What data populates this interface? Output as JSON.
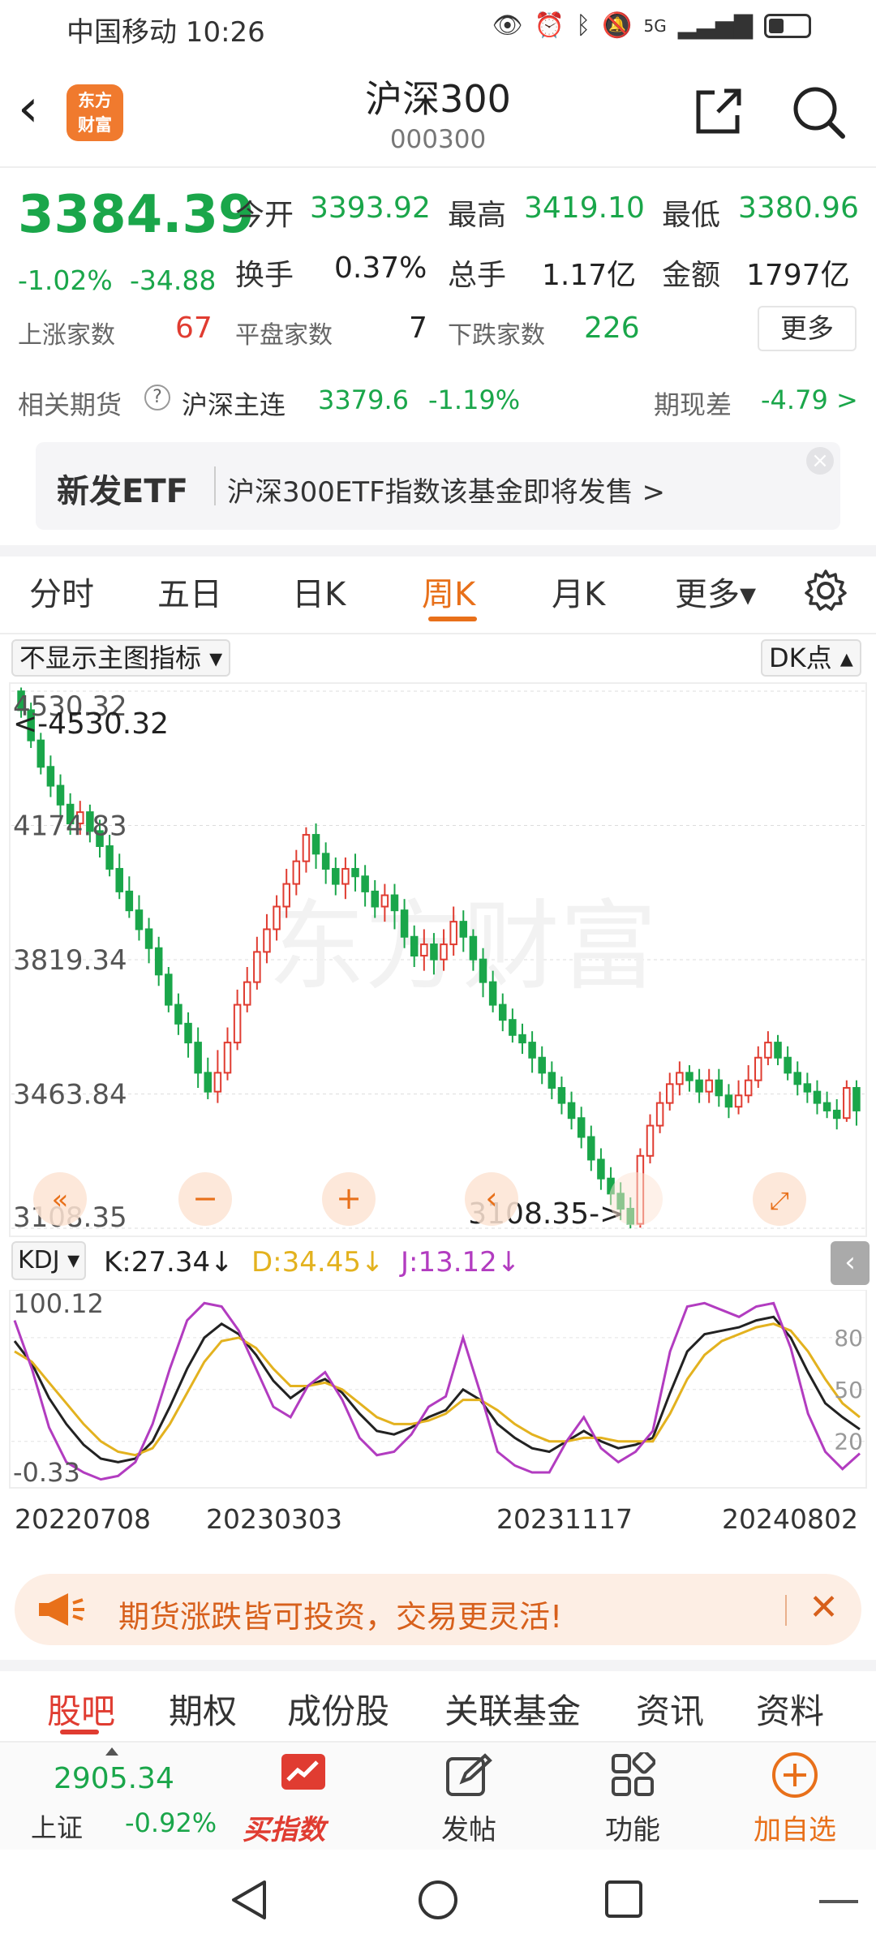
{
  "status_bar": {
    "carrier_time": "中国移动 10:26",
    "signal": "5G"
  },
  "nav": {
    "logo_text": "东方财富",
    "title": "沪深300",
    "code": "000300"
  },
  "quote": {
    "price": "3384.39",
    "change_pct": "-1.02%",
    "change": "-34.88",
    "open_label": "今开",
    "open": "3393.92",
    "high_label": "最高",
    "high": "3419.10",
    "low_label": "最低",
    "low": "3380.96",
    "turnover_label": "换手",
    "turnover": "0.37%",
    "volume_label": "总手",
    "volume": "1.17亿",
    "amount_label": "金额",
    "amount": "1797亿",
    "up_label": "上涨家数",
    "up": "67",
    "flat_label": "平盘家数",
    "flat": "7",
    "down_label": "下跌家数",
    "down": "226",
    "more_label": "更多"
  },
  "futures": {
    "label": "相关期货",
    "name": "沪深主连",
    "price": "3379.6",
    "pct": "-1.19%",
    "basis_label": "期现差",
    "basis": "-4.79 >"
  },
  "banner": {
    "tag": "新发ETF",
    "text": "沪深300ETF指数该基金即将发售  >",
    "close": "×"
  },
  "period_tabs": [
    "分时",
    "五日",
    "日K",
    "周K",
    "月K",
    "更多▾"
  ],
  "chart_controls": {
    "indicator_select": "不显示主图指标 ▾",
    "dk_point": "DK点 ▴"
  },
  "chart_data": [
    {
      "type": "candlestick",
      "y_ticks": [
        "4530.32",
        "4174.83",
        "3819.34",
        "3463.84",
        "3108.35"
      ],
      "ylim": [
        3108.35,
        4530.32
      ],
      "max_label": "<-4530.32",
      "min_label": "3108.35->",
      "watermark": "东方财富",
      "candles": [
        [
          4530,
          4480,
          4540,
          4460
        ],
        [
          4480,
          4400,
          4500,
          4380
        ],
        [
          4400,
          4330,
          4420,
          4310
        ],
        [
          4330,
          4280,
          4360,
          4250
        ],
        [
          4280,
          4230,
          4310,
          4200
        ],
        [
          4230,
          4180,
          4260,
          4150
        ],
        [
          4180,
          4210,
          4240,
          4150
        ],
        [
          4210,
          4160,
          4230,
          4130
        ],
        [
          4160,
          4120,
          4190,
          4090
        ],
        [
          4120,
          4060,
          4150,
          4040
        ],
        [
          4060,
          4000,
          4100,
          3980
        ],
        [
          4000,
          3950,
          4040,
          3930
        ],
        [
          3950,
          3900,
          3990,
          3870
        ],
        [
          3900,
          3850,
          3930,
          3810
        ],
        [
          3850,
          3780,
          3880,
          3750
        ],
        [
          3780,
          3700,
          3800,
          3680
        ],
        [
          3700,
          3650,
          3730,
          3620
        ],
        [
          3650,
          3600,
          3680,
          3560
        ],
        [
          3600,
          3520,
          3640,
          3480
        ],
        [
          3520,
          3470,
          3560,
          3450
        ],
        [
          3470,
          3520,
          3580,
          3440
        ],
        [
          3520,
          3600,
          3640,
          3500
        ],
        [
          3600,
          3700,
          3740,
          3580
        ],
        [
          3700,
          3760,
          3800,
          3680
        ],
        [
          3760,
          3840,
          3880,
          3740
        ],
        [
          3840,
          3900,
          3940,
          3810
        ],
        [
          3900,
          3960,
          3990,
          3870
        ],
        [
          3960,
          4020,
          4060,
          3930
        ],
        [
          4020,
          4080,
          4110,
          3990
        ],
        [
          4080,
          4150,
          4170,
          4050
        ],
        [
          4150,
          4100,
          4180,
          4060
        ],
        [
          4100,
          4060,
          4130,
          4020
        ],
        [
          4060,
          4020,
          4090,
          3990
        ],
        [
          4020,
          4060,
          4090,
          3980
        ],
        [
          4060,
          4040,
          4100,
          4000
        ],
        [
          4040,
          4000,
          4070,
          3960
        ],
        [
          4000,
          3960,
          4030,
          3930
        ],
        [
          3960,
          3990,
          4020,
          3920
        ],
        [
          3990,
          3950,
          4020,
          3900
        ],
        [
          3950,
          3880,
          3980,
          3850
        ],
        [
          3880,
          3830,
          3910,
          3800
        ],
        [
          3830,
          3860,
          3900,
          3790
        ],
        [
          3860,
          3820,
          3890,
          3780
        ],
        [
          3820,
          3860,
          3900,
          3790
        ],
        [
          3860,
          3920,
          3960,
          3830
        ],
        [
          3920,
          3880,
          3950,
          3840
        ],
        [
          3880,
          3820,
          3900,
          3790
        ],
        [
          3820,
          3760,
          3850,
          3720
        ],
        [
          3760,
          3700,
          3790,
          3680
        ],
        [
          3700,
          3660,
          3730,
          3630
        ],
        [
          3660,
          3620,
          3690,
          3600
        ],
        [
          3620,
          3600,
          3650,
          3570
        ],
        [
          3600,
          3560,
          3630,
          3520
        ],
        [
          3560,
          3520,
          3590,
          3490
        ],
        [
          3520,
          3480,
          3550,
          3450
        ],
        [
          3480,
          3440,
          3510,
          3410
        ],
        [
          3440,
          3400,
          3470,
          3370
        ],
        [
          3400,
          3350,
          3430,
          3320
        ],
        [
          3350,
          3290,
          3380,
          3260
        ],
        [
          3290,
          3240,
          3320,
          3210
        ],
        [
          3240,
          3200,
          3270,
          3170
        ],
        [
          3200,
          3160,
          3230,
          3130
        ],
        [
          3160,
          3120,
          3190,
          3108
        ],
        [
          3120,
          3300,
          3320,
          3110
        ],
        [
          3300,
          3380,
          3410,
          3280
        ],
        [
          3380,
          3440,
          3470,
          3360
        ],
        [
          3440,
          3490,
          3520,
          3420
        ],
        [
          3490,
          3520,
          3550,
          3460
        ],
        [
          3520,
          3500,
          3540,
          3470
        ],
        [
          3500,
          3470,
          3530,
          3440
        ],
        [
          3470,
          3500,
          3530,
          3440
        ],
        [
          3500,
          3460,
          3530,
          3430
        ],
        [
          3460,
          3430,
          3490,
          3400
        ],
        [
          3430,
          3460,
          3500,
          3410
        ],
        [
          3460,
          3500,
          3540,
          3440
        ],
        [
          3500,
          3560,
          3590,
          3480
        ],
        [
          3560,
          3600,
          3630,
          3540
        ],
        [
          3600,
          3560,
          3620,
          3540
        ],
        [
          3560,
          3520,
          3590,
          3500
        ],
        [
          3520,
          3490,
          3550,
          3460
        ],
        [
          3490,
          3470,
          3520,
          3440
        ],
        [
          3470,
          3440,
          3500,
          3410
        ],
        [
          3440,
          3420,
          3470,
          3400
        ],
        [
          3420,
          3400,
          3450,
          3370
        ],
        [
          3400,
          3480,
          3500,
          3390
        ],
        [
          3480,
          3420,
          3500,
          3380
        ]
      ]
    },
    {
      "type": "line",
      "indicator": "KDJ",
      "values_label": {
        "k": "K:27.34↓",
        "d": "D:34.45↓",
        "j": "J:13.12↓"
      },
      "y_ticks_left": [
        "100.12",
        "-0.33"
      ],
      "y_ticks_right": [
        "80",
        "50",
        "20"
      ],
      "ylim": [
        -0.33,
        100.12
      ],
      "dates": [
        "20220708",
        "20230303",
        "20231117",
        "20240802"
      ],
      "colors": {
        "k": "#222222",
        "d": "#e3b21f",
        "j": "#b23cc0"
      },
      "series": [
        {
          "name": "K",
          "values": [
            78,
            65,
            45,
            30,
            18,
            10,
            8,
            10,
            20,
            40,
            62,
            80,
            88,
            82,
            70,
            55,
            45,
            52,
            56,
            48,
            36,
            26,
            24,
            28,
            34,
            38,
            50,
            44,
            30,
            22,
            16,
            14,
            20,
            26,
            20,
            16,
            18,
            22,
            48,
            72,
            82,
            84,
            86,
            90,
            92,
            80,
            60,
            42,
            34,
            27
          ]
        },
        {
          "name": "D",
          "values": [
            72,
            66,
            54,
            42,
            30,
            20,
            14,
            12,
            16,
            30,
            48,
            66,
            78,
            80,
            74,
            62,
            52,
            52,
            54,
            50,
            42,
            34,
            30,
            30,
            32,
            36,
            44,
            44,
            38,
            30,
            24,
            20,
            20,
            22,
            22,
            20,
            20,
            20,
            36,
            56,
            70,
            78,
            82,
            86,
            88,
            84,
            72,
            56,
            42,
            34
          ]
        },
        {
          "name": "J",
          "values": [
            90,
            62,
            28,
            8,
            2,
            -2,
            0,
            8,
            30,
            62,
            90,
            100,
            98,
            84,
            62,
            40,
            34,
            52,
            60,
            44,
            22,
            12,
            14,
            24,
            40,
            46,
            80,
            48,
            14,
            6,
            2,
            2,
            20,
            34,
            16,
            8,
            14,
            26,
            72,
            98,
            100,
            96,
            92,
            98,
            100,
            74,
            36,
            14,
            4,
            13
          ]
        }
      ]
    }
  ],
  "promo": {
    "text": "期货涨跌皆可投资，交易更灵活!",
    "close": "✕"
  },
  "bottom_tabs": [
    "股吧",
    "期权",
    "成份股",
    "关联基金",
    "资讯",
    "资料"
  ],
  "toolbar": {
    "index_name": "上证",
    "index_value": "2905.34",
    "index_pct": "-0.92%",
    "buy_index": "买指数",
    "post": "发帖",
    "functions": "功能",
    "add_watch": "加自选"
  }
}
